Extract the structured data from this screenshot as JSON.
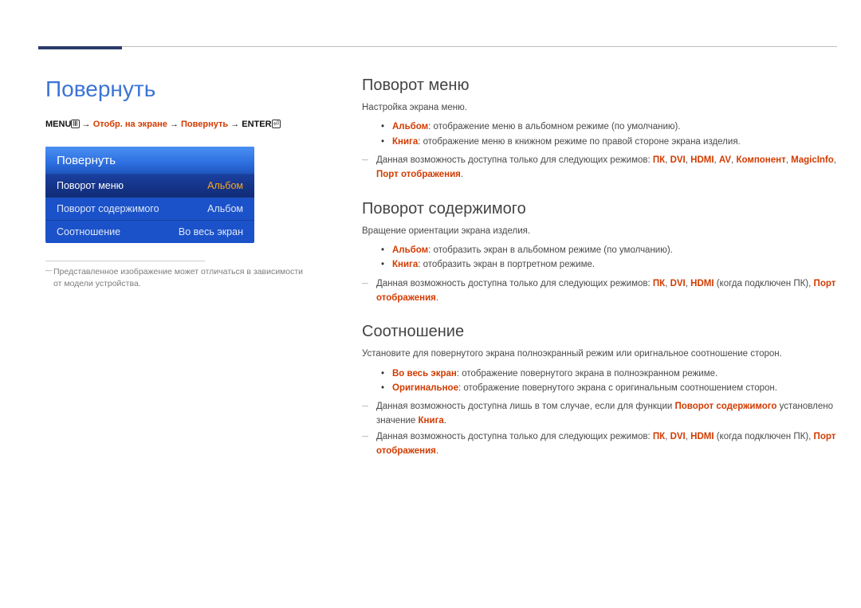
{
  "page_title": "Повернуть",
  "menupath": {
    "prefix": "MENU",
    "icon1": "Ⅲ",
    "arrow": "→",
    "step1": "Отобр. на экране",
    "step2": "Повернуть",
    "suffix": "ENTER",
    "icon2": "⏎"
  },
  "osd": {
    "title": "Повернуть",
    "rows": [
      {
        "label": "Поворот меню",
        "value": "Альбом",
        "hl": true
      },
      {
        "label": "Поворот содержимого",
        "value": "Альбом",
        "hl": false
      },
      {
        "label": "Соотношение",
        "value": "Во весь экран",
        "hl": false
      }
    ]
  },
  "footnote": "Представленное изображение может отличаться в зависимости от модели устройства.",
  "sections": {
    "s1": {
      "heading": "Поворот меню",
      "p1": "Настройка экрана меню.",
      "li1_hl": "Альбом",
      "li1_rest": ": отображение меню в альбомном режиме (по умолчанию).",
      "li2_hl": "Книга",
      "li2_rest": ": отображение меню в книжном режиме по правой стороне экрана изделия.",
      "note_pre": "Данная возможность доступна только для следующих режимов: ",
      "note_hl1": "ПК",
      "note_hl2": "DVI",
      "note_hl3": "HDMI",
      "note_hl4": "AV",
      "note_hl5": "Компонент",
      "note_hl6": "MagicInfo",
      "note_hl7": "Порт отображения",
      "sep": ", ",
      "dot": "."
    },
    "s2": {
      "heading": "Поворот содержимого",
      "p1": "Вращение ориентации экрана изделия.",
      "li1_hl": "Альбом",
      "li1_rest": ": отобразить экран в альбомном режиме (по умолчанию).",
      "li2_hl": "Книга",
      "li2_rest": ": отобразить экран в портретном режиме.",
      "note_pre": "Данная возможность доступна только для следующих режимов: ",
      "note_hl1": "ПК",
      "note_hl2": "DVI",
      "note_hl3": "HDMI",
      "note_paren": " (когда подключен ПК), ",
      "note_hl4": "Порт отображения",
      "dot": "."
    },
    "s3": {
      "heading": "Соотношение",
      "p1": "Установите для повернутого экрана полноэкранный режим или оригнальное соотношение сторон.",
      "li1_hl": "Во весь экран",
      "li1_rest": ": отображение повернутого экрана в полноэкранном режиме.",
      "li2_hl": "Оригинальное",
      "li2_rest": ": отображение повернутого экрана с оригинальным соотношением сторон.",
      "note1_pre": "Данная возможность доступна лишь в том случае, если для функции ",
      "note1_hl1": "Поворот содержимого",
      "note1_mid": " установлено значение ",
      "note1_hl2": "Книга",
      "note2_pre": "Данная возможность доступна только для следующих режимов: ",
      "note2_hl1": "ПК",
      "note2_hl2": "DVI",
      "note2_hl3": "HDMI",
      "note2_paren": " (когда подключен ПК), ",
      "note2_hl4": "Порт отображения",
      "dot": "."
    }
  }
}
